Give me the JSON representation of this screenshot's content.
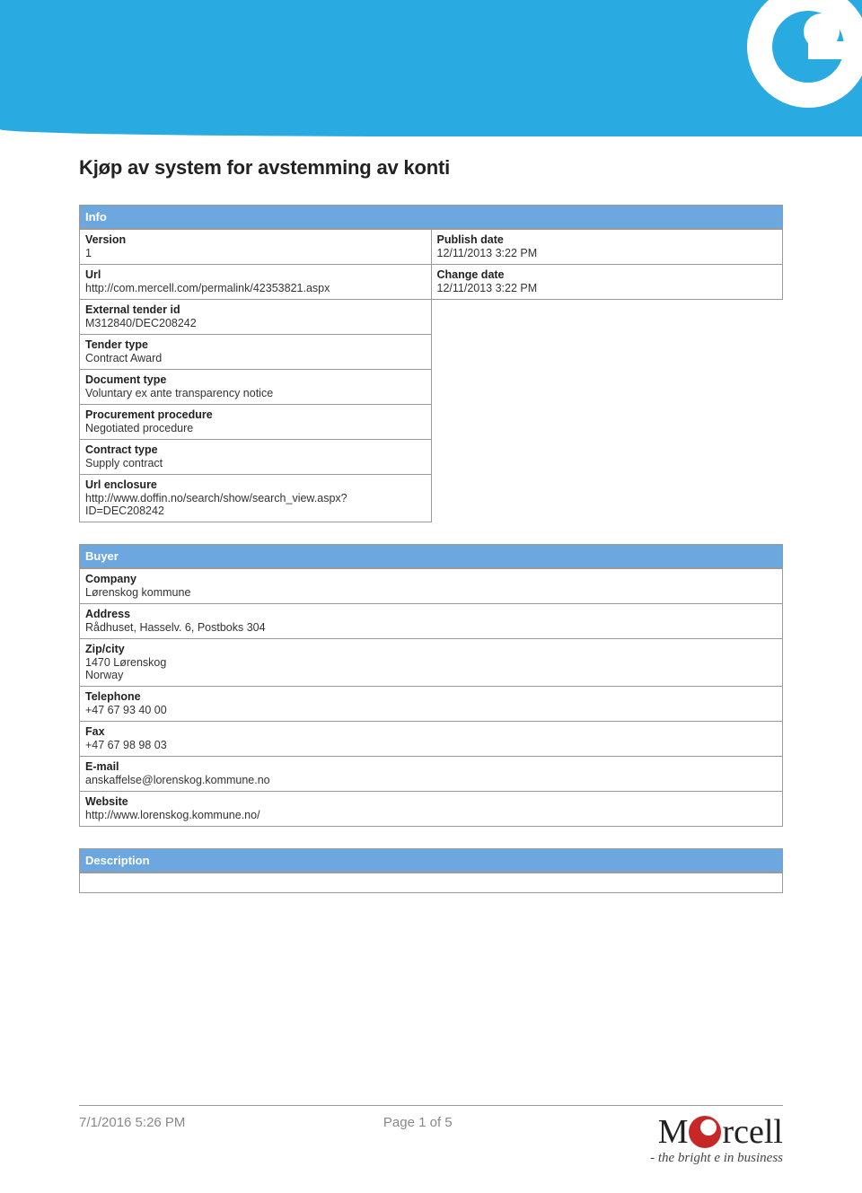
{
  "title": "Kjøp av system for avstemming av konti",
  "sections": {
    "info": {
      "header": "Info",
      "left": [
        {
          "label": "Version",
          "value": "1"
        },
        {
          "label": "Url",
          "value": "http://com.mercell.com/permalink/42353821.aspx"
        },
        {
          "label": "External tender id",
          "value": "M312840/DEC208242"
        },
        {
          "label": "Tender type",
          "value": "Contract Award"
        },
        {
          "label": "Document type",
          "value": "Voluntary ex ante transparency notice"
        },
        {
          "label": "Procurement procedure",
          "value": "Negotiated procedure"
        },
        {
          "label": "Contract type",
          "value": "Supply contract"
        },
        {
          "label": "Url enclosure",
          "value": "http://www.doffin.no/search/show/search_view.aspx?ID=DEC208242"
        }
      ],
      "right": [
        {
          "label": "Publish date",
          "value": "12/11/2013 3:22 PM"
        },
        {
          "label": "Change date",
          "value": "12/11/2013 3:22 PM"
        }
      ]
    },
    "buyer": {
      "header": "Buyer",
      "rows": [
        {
          "label": "Company",
          "value": "Lørenskog kommune"
        },
        {
          "label": "Address",
          "value": "Rådhuset, Hasselv. 6, Postboks 304"
        },
        {
          "label": "Zip/city",
          "value": "1470 Lørenskog\nNorway"
        },
        {
          "label": "Telephone",
          "value": "+47 67 93 40 00"
        },
        {
          "label": "Fax",
          "value": "+47 67 98 98 03"
        },
        {
          "label": "E-mail",
          "value": "anskaffelse@lorenskog.kommune.no"
        },
        {
          "label": "Website",
          "value": "http://www.lorenskog.kommune.no/"
        }
      ]
    },
    "description": {
      "header": "Description"
    }
  },
  "footer": {
    "date": "7/1/2016 5:26 PM",
    "page": "Page 1 of 5",
    "brand_parts": {
      "pre": "M",
      "post": "rcell"
    },
    "tagline": "- the bright e in business"
  }
}
